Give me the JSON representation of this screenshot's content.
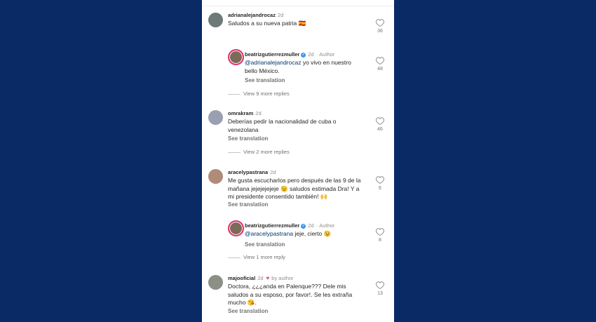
{
  "comments": [
    {
      "username": "adrianalejandrocaz",
      "age": "2d",
      "text": "Saludos a su nueva patria 🇪🇸",
      "likes": "36",
      "reply": {
        "username": "beatrizgutierrezmuller",
        "age": "2d",
        "author_label": "Author",
        "mention": "@adrianalejandrocaz",
        "text": " yo vivo en nuestro bello México.",
        "likes": "48",
        "translate": "See translation"
      },
      "more_replies": "View 9 more replies"
    },
    {
      "username": "omrakram",
      "age": "2d",
      "text": "Deberías pedir la nacionalidad de cuba o venezolana",
      "likes": "46",
      "translate": "See translation",
      "more_replies": "View 2 more replies"
    },
    {
      "username": "aracelypastrana",
      "age": "2d",
      "text": "Me gusta escucharlos pero después de las 9 de la mañana jejejejejeje 😉 saludos estimada Dra! Y a mi presidente consentido también! 🙌",
      "likes": "6",
      "translate": "See translation",
      "reply": {
        "username": "beatrizgutierrezmuller",
        "age": "2d",
        "author_label": "Author",
        "mention": "@aracelypastrana",
        "text": " jeje, cierto 😉",
        "likes": "8",
        "translate": "See translation"
      },
      "more_replies": "View 1 more reply"
    },
    {
      "username": "majooficial",
      "age": "2d",
      "by_author": "by author",
      "text": "Doctora, ¿¿¿anda en Palenque??? Dele mis saludos a su esposo, por favor!. Se les extraña mucho 😘.",
      "likes": "13",
      "translate": "See translation"
    }
  ],
  "colors": {
    "background": "#0a2a66",
    "author_ring": "#e1306c",
    "verified": "#3897f0",
    "heart": "#ed4956"
  },
  "icons": {
    "like": "heart-outline-icon",
    "verified": "verified-badge-icon",
    "liked_by_author": "red-heart-icon"
  }
}
